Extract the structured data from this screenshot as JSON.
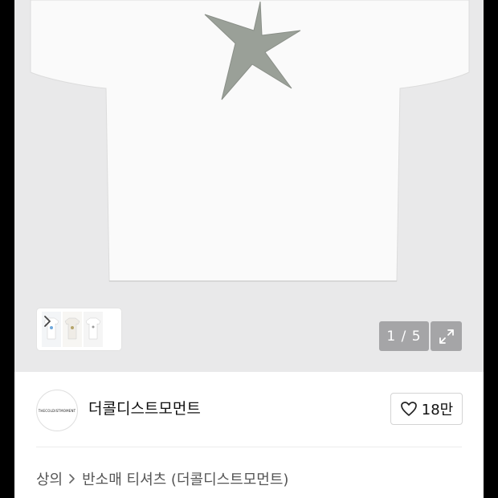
{
  "gallery": {
    "counter": "1 / 5",
    "thumbnail_brand_text": "THECOLDISTMOMENT"
  },
  "brand": {
    "name": "더콜디스트모먼트",
    "logo_text": "THECOLDISTMOMENT",
    "likes": "18만"
  },
  "breadcrumb": {
    "category": "상의",
    "product": "반소매 티셔츠 (더콜디스트모먼트)"
  },
  "icons": {
    "thumb_next": "chevron-right-icon",
    "expand": "expand-arrows-icon",
    "like": "heart-outline-icon",
    "separator": "chevron-right-icon"
  },
  "colors": {
    "gallery_bg": "#e9e9ea",
    "counter_bg": "#a5a5a7",
    "starfish": "#9aa098"
  }
}
